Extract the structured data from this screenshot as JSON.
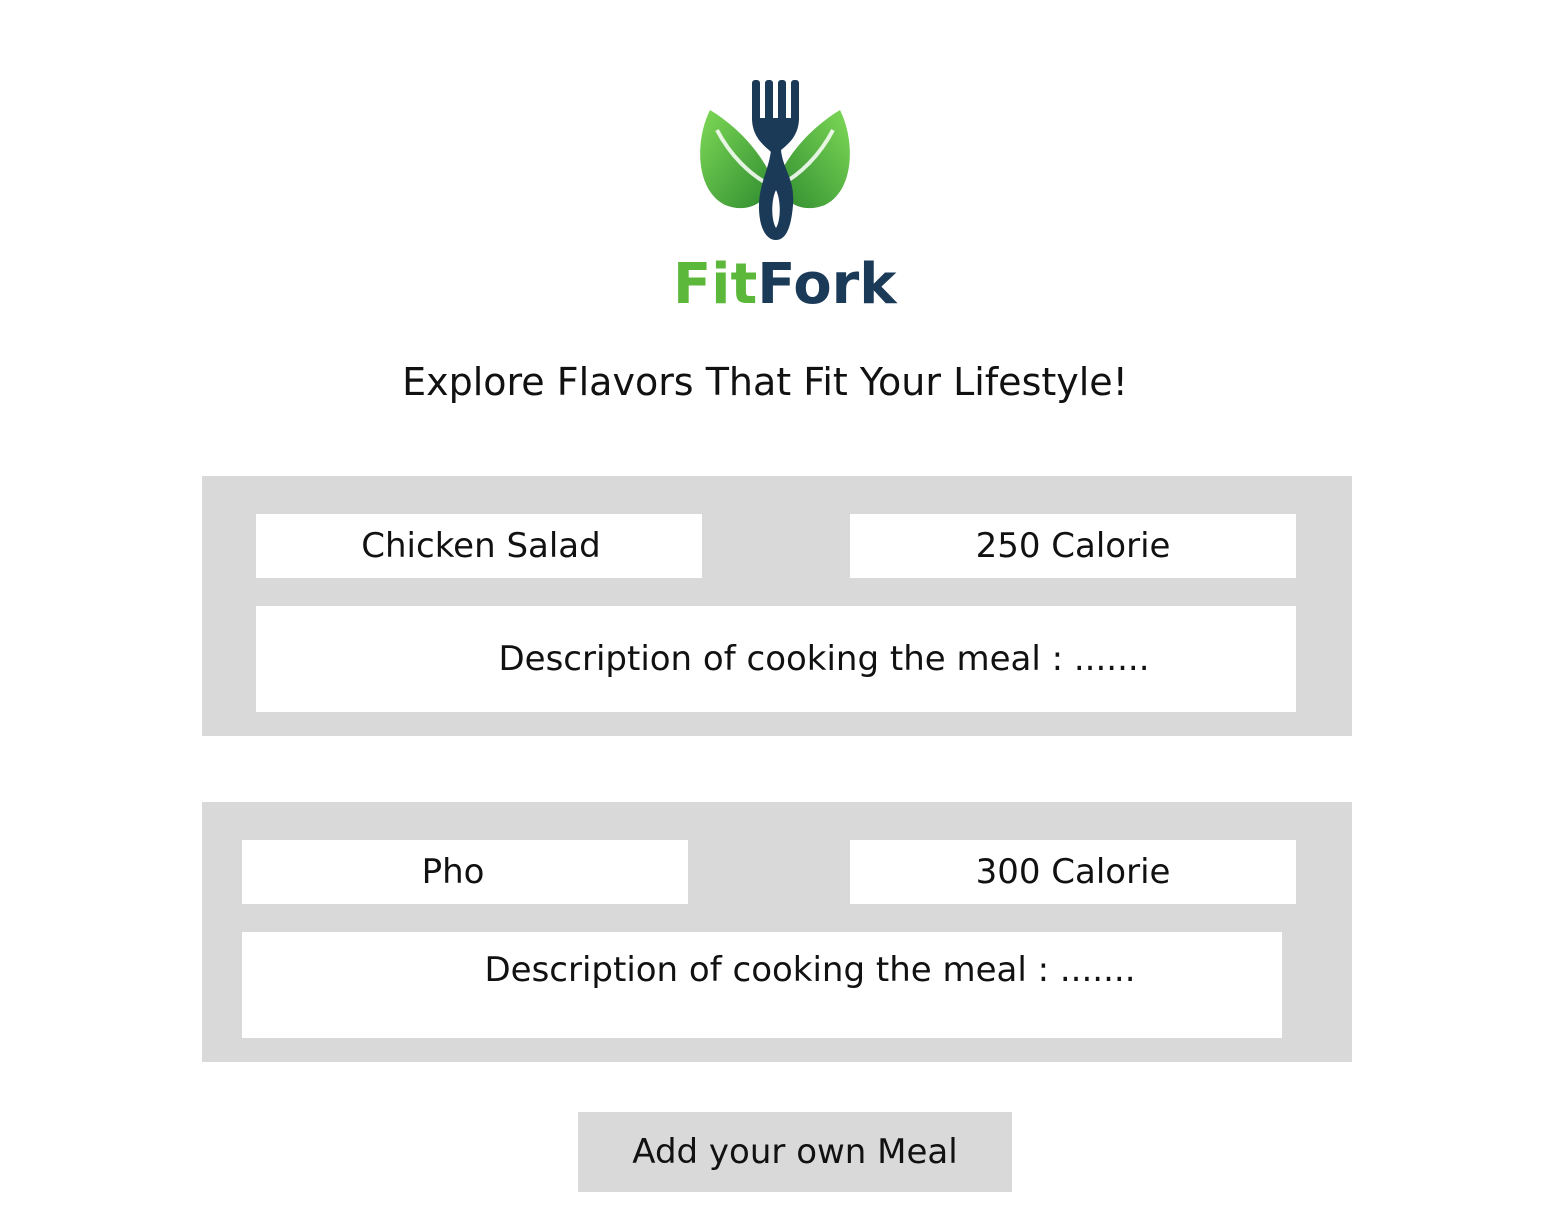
{
  "brand": {
    "logo_text_fit": "Fit",
    "logo_text_fork": "Fork",
    "colors": {
      "green": "#5cb83a",
      "dark_green": "#2e7d32",
      "navy": "#1b3a57"
    }
  },
  "tagline": "Explore Flavors That Fit Your Lifestyle!",
  "meals": [
    {
      "name": "Chicken Salad",
      "calories": "250 Calorie",
      "description": "Description of cooking the meal : ......."
    },
    {
      "name": "Pho",
      "calories": "300 Calorie",
      "description": "Description of cooking the meal : ......."
    }
  ],
  "actions": {
    "add_meal_label": "Add your own Meal"
  }
}
